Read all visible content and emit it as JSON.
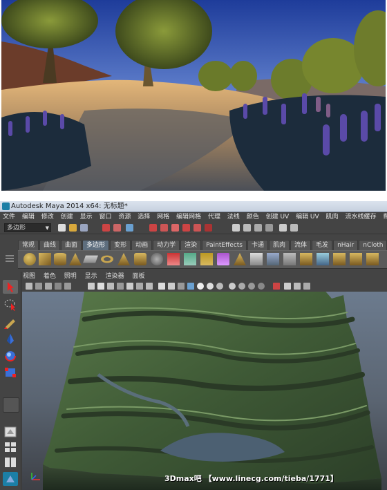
{
  "window": {
    "title": "Autodesk Maya 2014 x64: 无标题*"
  },
  "menubar": {
    "items": [
      "文件",
      "编辑",
      "修改",
      "创建",
      "显示",
      "窗口",
      "资源",
      "选择",
      "网格",
      "编辑网格",
      "代理",
      "法线",
      "颜色",
      "创建 UV",
      "编辑 UV",
      "肌肉",
      "流水线缓存",
      "帮助"
    ]
  },
  "statusline": {
    "mode": "多边形"
  },
  "shelf": {
    "tabs": [
      "常规",
      "曲线",
      "曲面",
      "多边形",
      "变形",
      "动画",
      "动力学",
      "渲染",
      "PaintEffects",
      "卡通",
      "肌肉",
      "流体",
      "毛发",
      "nHair",
      "nCloth"
    ],
    "active_tab": "多边形"
  },
  "panel": {
    "menu": [
      "视图",
      "着色",
      "照明",
      "显示",
      "渲染器",
      "面板"
    ]
  },
  "watermark": "3Dmax吧 【www.linecg.com/tieba/1771】",
  "colors": {
    "maya_bg": "#444444",
    "viewport_top": "#6c7b8e",
    "terrain_green": "#3f5a36"
  }
}
